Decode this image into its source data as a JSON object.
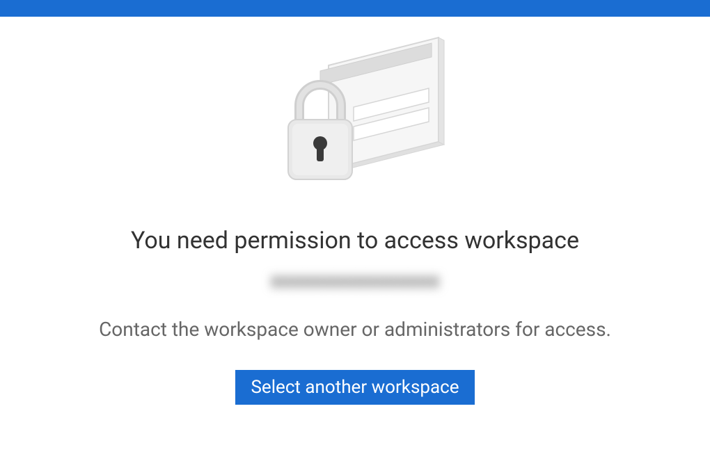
{
  "colors": {
    "primary": "#1a6dd2"
  },
  "permission_error": {
    "heading": "You need permission to access workspace",
    "workspace_name": "xxxxxxxxxxxxxxxx",
    "subtext": "Contact the workspace owner or administrators for access.",
    "button_label": "Select another workspace",
    "icon_name": "lock-card-icon"
  }
}
